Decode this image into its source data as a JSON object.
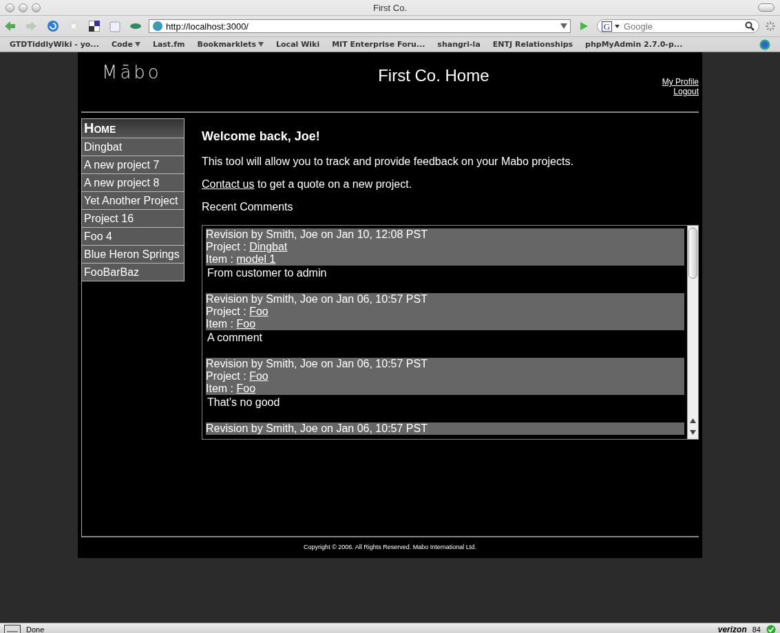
{
  "window": {
    "title": "First Co."
  },
  "toolbar": {
    "url": "http://localhost:3000/",
    "search": {
      "engine": "G",
      "placeholder": "Google"
    }
  },
  "bookmarks": [
    {
      "label": "GTDTiddlyWiki - yo...",
      "menu": false
    },
    {
      "label": "Code",
      "menu": true
    },
    {
      "label": "Last.fm",
      "menu": false
    },
    {
      "label": "Bookmarklets",
      "menu": true
    },
    {
      "label": "Local Wiki",
      "menu": false
    },
    {
      "label": "MIT Enterprise Foru...",
      "menu": false
    },
    {
      "label": "shangri-la",
      "menu": false
    },
    {
      "label": "ENTJ Relationships",
      "menu": false
    },
    {
      "label": "phpMyAdmin 2.7.0-p...",
      "menu": false
    }
  ],
  "page": {
    "logo": "Mābo",
    "title": "First Co. Home",
    "user_links": [
      "My Profile",
      "Logout"
    ],
    "sidebar": {
      "items": [
        {
          "label": "Home",
          "selected": true
        },
        {
          "label": "Dingbat",
          "selected": false
        },
        {
          "label": "A new project 7",
          "selected": false
        },
        {
          "label": "A new project 8",
          "selected": false
        },
        {
          "label": "Yet Another Project",
          "selected": false
        },
        {
          "label": "Project 16",
          "selected": false
        },
        {
          "label": "Foo 4",
          "selected": false
        },
        {
          "label": "Blue Heron Springs",
          "selected": false
        },
        {
          "label": "FooBarBaz",
          "selected": false
        }
      ]
    },
    "welcome": "Welcome back, Joe!",
    "intro": "This tool will allow you to track and provide feedback on your Mabo projects.",
    "contact": {
      "link": "Contact us",
      "text": "to get a quote on a new project."
    },
    "recent_heading": "Recent Comments",
    "comments": [
      {
        "header": "Revision by Smith, Joe on Jan 10, 12:08 PST",
        "project_label": "Project :",
        "project": "Dingbat",
        "item_label": "Item :",
        "item": "model 1",
        "body": "From customer to admin"
      },
      {
        "header": "Revision by Smith, Joe on Jan 06, 10:57 PST",
        "project_label": "Project :",
        "project": "Foo",
        "item_label": "Item :",
        "item": "Foo",
        "body": "A comment"
      },
      {
        "header": "Revision by Smith, Joe on Jan 06, 10:57 PST",
        "project_label": "Project :",
        "project": "Foo",
        "item_label": "Item :",
        "item": "Foo",
        "body": "That's no good"
      },
      {
        "header": "Revision by Smith, Joe on Jan 06, 10:57 PST"
      }
    ],
    "footer": "Copyright © 2006. All Rights Reserved. Mabo International Ltd."
  },
  "status_bar": {
    "text": "Done",
    "carrier": "verizon",
    "signal": "84"
  }
}
